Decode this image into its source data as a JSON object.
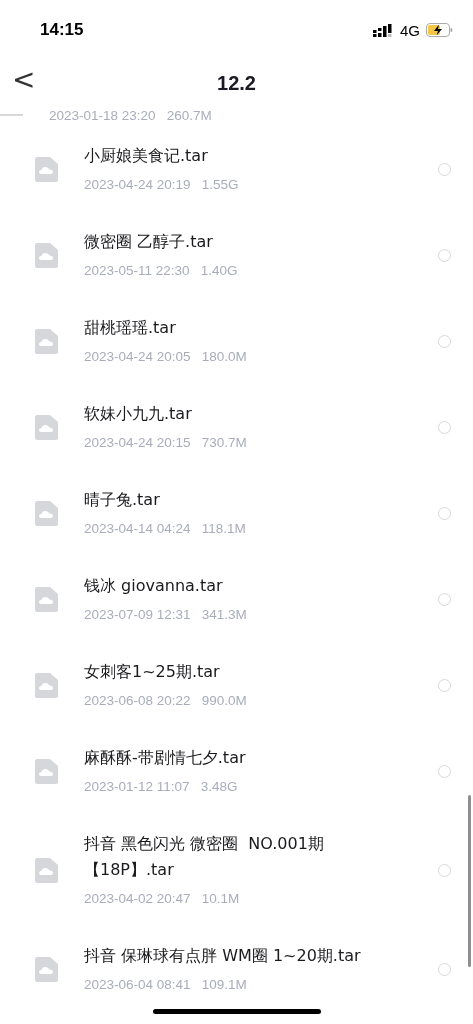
{
  "status_bar": {
    "time": "14:15",
    "network": "4G"
  },
  "nav": {
    "back": "<",
    "title": "12.2"
  },
  "files": [
    {
      "kind": "cut",
      "meta": "2023-01-18 23:20   260.7M"
    },
    {
      "name": "小厨娘美食记.tar",
      "meta": "2023-04-24 20:19   1.55G",
      "selected": false
    },
    {
      "name": "微密圈 乙醇子.tar",
      "meta": "2023-05-11 22:30   1.40G",
      "selected": false
    },
    {
      "name": "甜桃瑶瑶.tar",
      "meta": "2023-04-24 20:05   180.0M",
      "selected": false
    },
    {
      "name": "软妹小九九.tar",
      "meta": "2023-04-24 20:15   730.7M",
      "selected": false
    },
    {
      "name": "晴子兔.tar",
      "meta": "2023-04-14 04:24   118.1M",
      "selected": false
    },
    {
      "name": "钱冰 giovanna.tar",
      "meta": "2023-07-09 12:31   341.3M",
      "selected": false
    },
    {
      "name": "女刺客1~25期.tar",
      "meta": "2023-06-08 20:22   990.0M",
      "selected": false
    },
    {
      "name": "麻酥酥-带剧情七夕.tar",
      "meta": "2023-01-12 11:07   3.48G",
      "selected": false
    },
    {
      "name": "抖音 黑色闪光 微密圈  NO.001期【18P】.tar",
      "meta": "2023-04-02 20:47   10.1M",
      "selected": false
    },
    {
      "name": "抖音 保琳球有点胖 WM圈 1~20期.tar",
      "meta": "2023-06-04 08:41   109.1M",
      "selected": false
    }
  ]
}
